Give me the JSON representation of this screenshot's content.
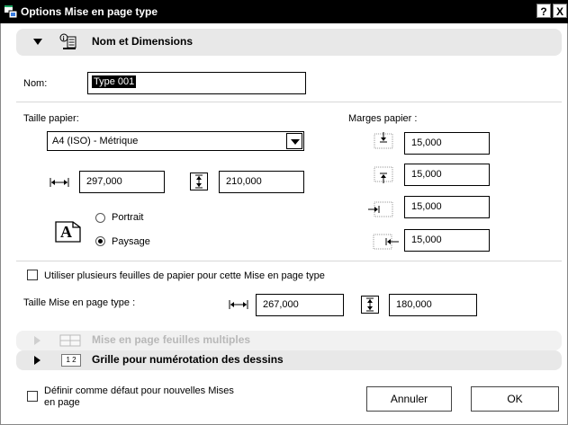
{
  "window": {
    "title": "Options Mise en page type",
    "help_label": "?",
    "close_label": "X"
  },
  "section_nom": {
    "title": "Nom et Dimensions"
  },
  "nom": {
    "label": "Nom:",
    "value": "Type 001"
  },
  "paper": {
    "size_label": "Taille papier:",
    "size_value": "A4 (ISO) - Métrique",
    "width": "297,000",
    "height": "210,000",
    "orientation_portrait": "Portrait",
    "orientation_landscape": "Paysage",
    "orientation_selected": "Paysage",
    "orientation_icon_letter": "A"
  },
  "margins": {
    "label": "Marges papier :",
    "top": "15,000",
    "bottom": "15,000",
    "left": "15,000",
    "right": "15,000"
  },
  "multi_sheet": {
    "label": "Utiliser plusieurs feuilles de papier pour cette Mise en page type",
    "checked": false
  },
  "layout_size": {
    "label": "Taille Mise en page type :",
    "width": "267,000",
    "height": "180,000"
  },
  "section_multi": {
    "title": "Mise en page feuilles multiples"
  },
  "section_grille": {
    "title": "Grille pour numérotation des dessins",
    "icon_text": "1 2"
  },
  "default_option": {
    "label_line1": "Définir comme défaut pour nouvelles Mises",
    "label_line2": "en page",
    "checked": false
  },
  "buttons": {
    "cancel": "Annuler",
    "ok": "OK"
  }
}
